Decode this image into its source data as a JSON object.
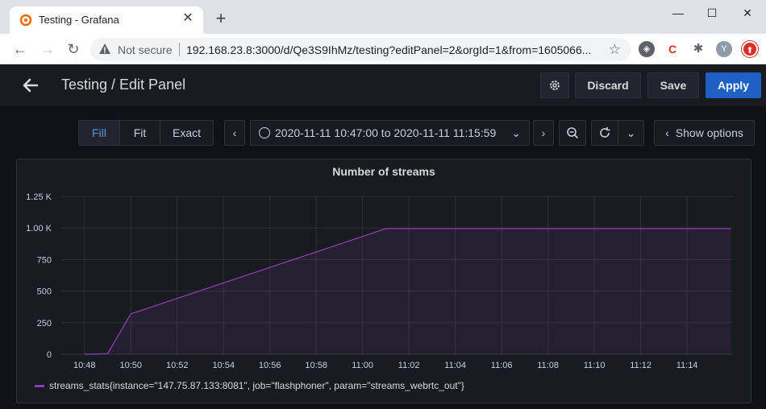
{
  "browser": {
    "tab_title": "Testing - Grafana",
    "new_tab": "+",
    "not_secure": "Not secure",
    "url": "192.168.23.8:3000/d/Qe3S9IhMz/testing?editPanel=2&orgId=1&from=1605066...",
    "profile_initial": "Y"
  },
  "header": {
    "title": "Testing / Edit Panel",
    "discard_label": "Discard",
    "save_label": "Save",
    "apply_label": "Apply"
  },
  "toolbar": {
    "fill_label": "Fill",
    "fit_label": "Fit",
    "exact_label": "Exact",
    "time_range": "2020-11-11 10:47:00 to 2020-11-11 11:15:59",
    "show_options_label": "Show options"
  },
  "chart_data": {
    "type": "area",
    "title": "Number of streams",
    "x": [
      "10:48",
      "10:49",
      "10:50",
      "10:50.5",
      "11:01",
      "11:15.9"
    ],
    "series": [
      {
        "name": "streams_stats{instance=\"147.75.87.133:8081\", job=\"flashphoner\", param=\"streams_webrtc_out\"}",
        "values": [
          0,
          5,
          320,
          350,
          995,
          995
        ]
      }
    ],
    "x_tick_labels": [
      "10:48",
      "10:50",
      "10:52",
      "10:54",
      "10:56",
      "10:58",
      "11:00",
      "11:02",
      "11:04",
      "11:06",
      "11:08",
      "11:10",
      "11:12",
      "11:14"
    ],
    "y_tick_labels": [
      "0",
      "250",
      "500",
      "750",
      "1.00 K",
      "1.25 K"
    ],
    "y_ticks": [
      0,
      250,
      500,
      750,
      1000,
      1250
    ],
    "ylim": [
      0,
      1250
    ],
    "grid": true,
    "legend": "bottom-left",
    "line_color": "#8f3bb8"
  }
}
